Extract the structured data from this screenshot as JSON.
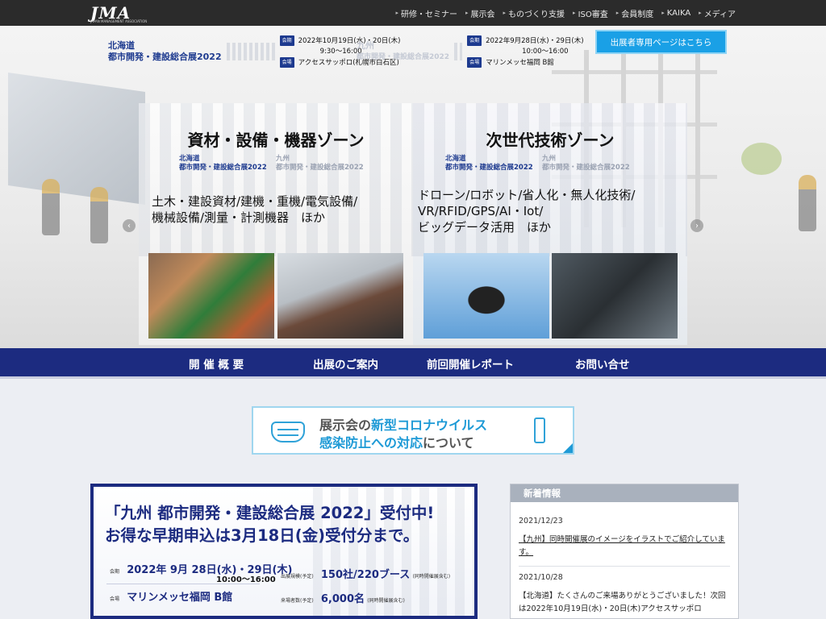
{
  "header": {
    "logo": "JMA",
    "logo_sub": "JAPAN MANAGEMENT ASSOCIATION",
    "nav": [
      "研修・セミナー",
      "展示会",
      "ものづくり支援",
      "ISO審査",
      "会員制度",
      "KAIKA",
      "メディア"
    ]
  },
  "expos": {
    "hokkaido": {
      "title_line1": "北海道",
      "title_line2": "都市開発・建設総合展2022",
      "date_tag": "会期",
      "date": "2022年10月19日(水)・20日(木)",
      "time": "9:30～16:00",
      "venue_tag": "会場",
      "venue": "アクセスサッポロ(札幌市白石区)"
    },
    "kyushu": {
      "title_line1": "九州",
      "title_line2": "都市開発・建設総合展2022",
      "date_tag": "会期",
      "date": "2022年9月28日(水)・29日(木)",
      "time": "10:00～16:00",
      "venue_tag": "会場",
      "venue": "マリンメッセ福岡 B館"
    },
    "exhibitor_button": "出展者専用ページはこちら"
  },
  "zones": {
    "left": {
      "title": "資材・設備・機器ゾーン",
      "sub_a1": "北海道",
      "sub_a2": "都市開発・建設総合展2022",
      "sub_b1": "九州",
      "sub_b2": "都市開発・建設総合展2022",
      "list_line1": "土木・建設資材/建機・重機/電気設備/",
      "list_line2": "機械設備/測量・計測機器　ほか"
    },
    "right": {
      "title": "次世代技術ゾーン",
      "sub_a1": "北海道",
      "sub_a2": "都市開発・建設総合展2022",
      "sub_b1": "九州",
      "sub_b2": "都市開発・建設総合展2022",
      "list_line1": "ドローン/ロボット/省人化・無人化技術/",
      "list_line2": "VR/RFID/GPS/AI・Iot/",
      "list_line3": "ビッグデータ活用　ほか"
    },
    "prev_arrow": "‹",
    "next_arrow": "›"
  },
  "menu": [
    "開 催 概 要",
    "出展のご案内",
    "前回開催レポート",
    "お問い合せ"
  ],
  "covid": {
    "line1_a": "展示会の",
    "line1_b": "新型コロナウイルス",
    "line2_a": "感染防止への対応",
    "line2_b": "について"
  },
  "kyushu_panel": {
    "headline1": "「九州 都市開発・建設総合展 2022」受付中!",
    "headline2": "お得な早期申込は3月18日(金)受付分まで。",
    "date_label": "会期",
    "date": "2022年 9月 28日(水)・29日(木)",
    "time": "10:00～16:00",
    "venue_label": "会場",
    "venue": "マリンメッセ福岡 B館",
    "scale_label": "出展規模",
    "scale_note": "(予定)",
    "scale": "150社/220ブース",
    "scale_note2": "(同時開催展含む)",
    "visitors_label": "来場者数",
    "visitors_note": "(予定)",
    "visitors": "6,000名",
    "visitors_note2": "(同時開催展含む)"
  },
  "news": {
    "title": "新着情報",
    "items": [
      {
        "date": "2021/12/23",
        "text": "【九州】同時開催展のイメージをイラストでご紹介しています。"
      },
      {
        "date": "2021/10/28",
        "text": "【北海道】たくさんのご来場ありがとうございました！次回は2022年10月19日(水)・20日(木)アクセスサッポロ"
      }
    ]
  }
}
